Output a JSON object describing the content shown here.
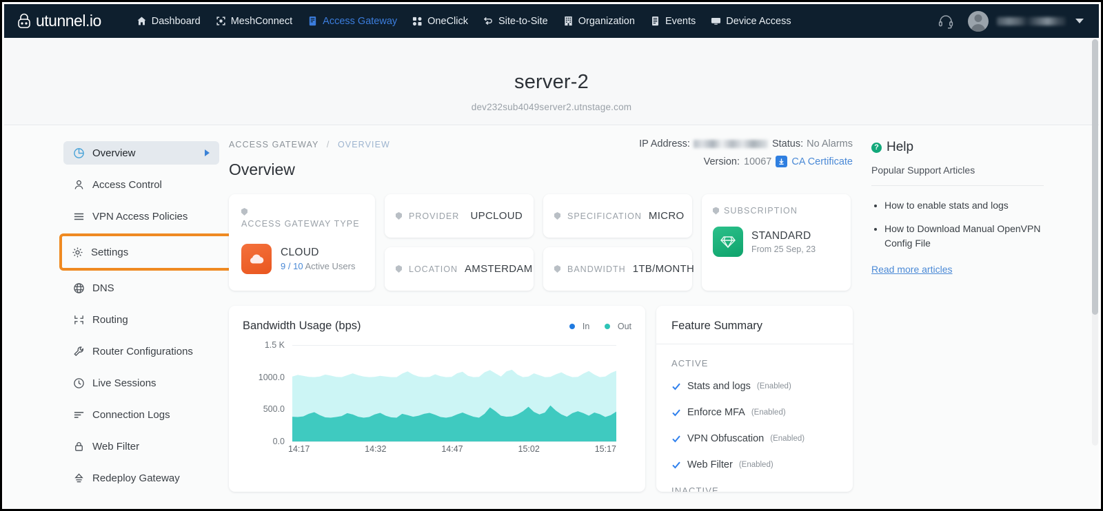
{
  "topnav": {
    "brand": "utunnel.io",
    "items": [
      {
        "label": "Dashboard",
        "icon": "home-icon",
        "active": false
      },
      {
        "label": "MeshConnect",
        "icon": "mesh-icon",
        "active": false
      },
      {
        "label": "Access Gateway",
        "icon": "gateway-icon",
        "active": true
      },
      {
        "label": "OneClick",
        "icon": "oneclick-icon",
        "active": false
      },
      {
        "label": "Site-to-Site",
        "icon": "site-to-site-icon",
        "active": false
      },
      {
        "label": "Organization",
        "icon": "building-icon",
        "active": false
      },
      {
        "label": "Events",
        "icon": "events-icon",
        "active": false
      },
      {
        "label": "Device Access",
        "icon": "monitor-icon",
        "active": false
      }
    ],
    "support_icon": "headset-icon",
    "user_name": "",
    "accent": "#3b7ddd",
    "background": "#0e1f2e"
  },
  "pagehead": {
    "title": "server-2",
    "subtitle": "dev232sub4049server2.utnstage.com"
  },
  "sidebar": {
    "items": [
      {
        "label": "Overview",
        "icon": "pie-chart-icon",
        "active": true,
        "highlighted": false
      },
      {
        "label": "Access Control",
        "icon": "user-icon",
        "active": false,
        "highlighted": false
      },
      {
        "label": "VPN Access Policies",
        "icon": "list-icon",
        "active": false,
        "highlighted": false
      },
      {
        "label": "Settings",
        "icon": "gear-icon",
        "active": false,
        "highlighted": true
      },
      {
        "label": "DNS",
        "icon": "globe-icon",
        "active": false,
        "highlighted": false
      },
      {
        "label": "Routing",
        "icon": "routing-icon",
        "active": false,
        "highlighted": false
      },
      {
        "label": "Router Configurations",
        "icon": "wrench-icon",
        "active": false,
        "highlighted": false
      },
      {
        "label": "Live Sessions",
        "icon": "clock-icon",
        "active": false,
        "highlighted": false
      },
      {
        "label": "Connection Logs",
        "icon": "logs-icon",
        "active": false,
        "highlighted": false
      },
      {
        "label": "Web Filter",
        "icon": "lock-icon",
        "active": false,
        "highlighted": false
      },
      {
        "label": "Redeploy Gateway",
        "icon": "redeploy-icon",
        "active": false,
        "highlighted": false
      }
    ],
    "highlight_color": "#ef8a22"
  },
  "main": {
    "breadcrumb_root": "ACCESS GATEWAY",
    "breadcrumb_sep": "/",
    "breadcrumb_current": "OVERVIEW",
    "title": "Overview",
    "meta": {
      "ip_label": "IP Address:",
      "ip_value": "",
      "status_label": "Status:",
      "status_value": "No Alarms",
      "version_label": "Version:",
      "version_value": "10067",
      "ca_cert_label": "CA Certificate",
      "download_icon": "download-icon"
    },
    "cards": {
      "gateway_type": {
        "label": "ACCESS GATEWAY TYPE",
        "icon": "cloud-icon",
        "value": "CLOUD",
        "users_active": "9",
        "users_sep": "/",
        "users_total": "10",
        "users_suffix": "Active Users"
      },
      "provider": {
        "label": "PROVIDER",
        "value": "UPCLOUD"
      },
      "location": {
        "label": "LOCATION",
        "value": "AMSTERDAM"
      },
      "specification": {
        "label": "SPECIFICATION",
        "value": "MICRO"
      },
      "bandwidth": {
        "label": "BANDWIDTH",
        "value": "1TB/MONTH"
      },
      "subscription": {
        "label": "SUBSCRIPTION",
        "icon": "gem-icon",
        "plan": "STANDARD",
        "from": "From 25 Sep, 23"
      }
    }
  },
  "chart_data": {
    "type": "area",
    "title": "Bandwidth Usage (bps)",
    "xlabel": "",
    "ylabel": "",
    "ylim": [
      0,
      1500
    ],
    "yticks": [
      "0.0",
      "500.0",
      "1000.0",
      "1.5 K"
    ],
    "ytick_values": [
      0,
      500,
      1000,
      1500
    ],
    "xticks": [
      "14:17",
      "14:32",
      "14:47",
      "15:02",
      "15:17"
    ],
    "grid": true,
    "legend_position": "top-right",
    "series": [
      {
        "name": "In",
        "color": "#1f7ae0",
        "fill": "#ccf5f5",
        "values": [
          1010,
          1035,
          1020,
          1005,
          1000,
          1010,
          1040,
          1025,
          1005,
          1000,
          1030,
          1060,
          1030,
          1010,
          1000,
          1005,
          1020,
          1010,
          1000,
          1000,
          1055,
          1090,
          1040,
          1010,
          1000,
          1005,
          1045,
          1015,
          1000,
          1005,
          1060,
          1085,
          1020,
          1000,
          1005,
          1075,
          1110,
          1060,
          1010,
          1090,
          1115,
          1040,
          1000,
          1010,
          1060,
          1030,
          1000,
          1005,
          1045,
          1075,
          1030,
          1000,
          1005,
          1055,
          1095,
          1040,
          1000,
          1010,
          1065,
          1100
        ]
      },
      {
        "name": "Out",
        "color": "#2ec4b6",
        "fill": "#3fcac0",
        "values": [
          385,
          380,
          390,
          430,
          455,
          410,
          375,
          370,
          380,
          395,
          440,
          420,
          385,
          370,
          380,
          420,
          445,
          400,
          375,
          370,
          430,
          410,
          385,
          400,
          430,
          445,
          415,
          380,
          370,
          385,
          420,
          450,
          415,
          385,
          370,
          430,
          530,
          470,
          400,
          385,
          390,
          420,
          470,
          540,
          460,
          420,
          450,
          560,
          480,
          420,
          385,
          440,
          470,
          440,
          400,
          450,
          425,
          380,
          410,
          465
        ]
      }
    ]
  },
  "feature_summary": {
    "title": "Feature Summary",
    "active_label": "ACTIVE",
    "items": [
      {
        "name": "Stats and logs",
        "state": "(Enabled)"
      },
      {
        "name": "Enforce MFA",
        "state": "(Enabled)"
      },
      {
        "name": "VPN Obfuscation",
        "state": "(Enabled)"
      },
      {
        "name": "Web Filter",
        "state": "(Enabled)"
      }
    ],
    "inactive_label": "INACTIVE"
  },
  "help": {
    "title": "Help",
    "subtitle": "Popular Support Articles",
    "articles": [
      "How to enable stats and logs",
      "How to Download Manual OpenVPN Config File"
    ],
    "more_link": "Read more articles"
  }
}
